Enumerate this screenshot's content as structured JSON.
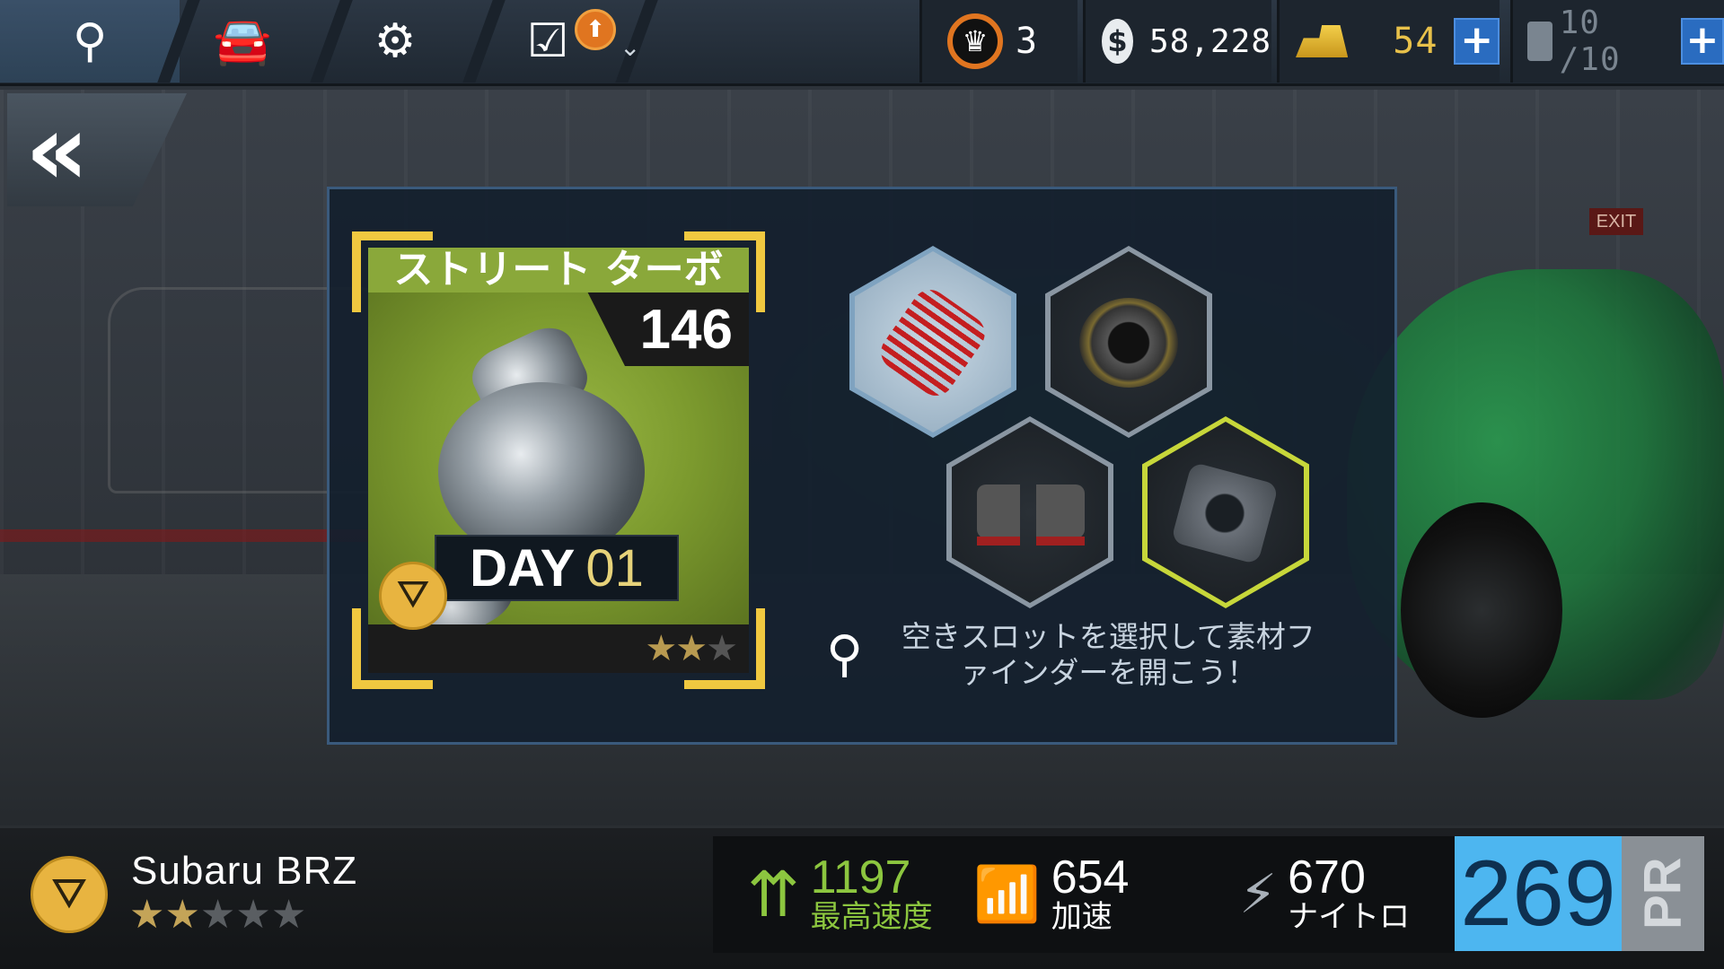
{
  "topbar": {
    "nav": [
      {
        "icon": "map-pin-icon",
        "glyph": "⚲"
      },
      {
        "icon": "car-icon",
        "glyph": "🚘"
      },
      {
        "icon": "gears-icon",
        "glyph": "⚙"
      },
      {
        "icon": "checklist-icon",
        "glyph": "☑"
      }
    ],
    "upgrade_badge_glyph": "⬆",
    "chevron_glyph": "⌄",
    "crowns": "3",
    "cash_symbol": "$",
    "cash": "58,228",
    "gold": "54",
    "fuel": "10 /10",
    "plus_glyph": "+"
  },
  "back": {
    "glyph": "«"
  },
  "card": {
    "title": "ストリート ターボ",
    "power": "146",
    "day_label": "DAY",
    "day_number": "01",
    "rarity_stars": 2,
    "rarity_max": 3,
    "class_glyph": "⛛"
  },
  "slots": [
    {
      "name": "spring",
      "state": "selected"
    },
    {
      "name": "bushing",
      "state": "empty"
    },
    {
      "name": "engine-mounts",
      "state": "empty"
    },
    {
      "name": "gasket",
      "state": "highlighted"
    }
  ],
  "hint": {
    "text_line1": "空きスロットを選択して素材フ",
    "text_line2": "ァインダーを開こう！"
  },
  "car": {
    "name": "Subaru BRZ",
    "stars": 2,
    "stars_max": 5,
    "class_glyph": "⛛"
  },
  "stats": {
    "top_speed_value": "1197",
    "top_speed_label": "最高速度",
    "accel_value": "654",
    "accel_label": "加速",
    "nitro_value": "670",
    "nitro_label": "ナイトロ"
  },
  "pr": {
    "value": "269",
    "label": "PR"
  },
  "colors": {
    "accent_blue": "#4db6f0",
    "lime": "#8aa83a",
    "gold": "#e8c14a",
    "speed_green": "#8cc63f"
  }
}
